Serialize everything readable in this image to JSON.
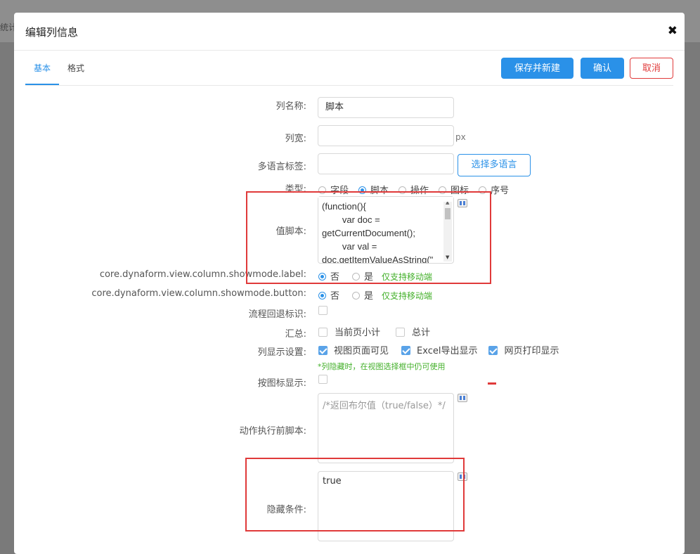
{
  "background": {
    "partial_text": "统计"
  },
  "dialog": {
    "title": "编辑列信息",
    "close_symbol": "✖"
  },
  "tabs": [
    {
      "label": "基本",
      "active": true
    },
    {
      "label": "格式",
      "active": false
    }
  ],
  "buttons": {
    "save_new": "保存并新建",
    "confirm": "确认",
    "cancel": "取消"
  },
  "form": {
    "column_name": {
      "label": "列名称:",
      "value": "脚本"
    },
    "column_width": {
      "label": "列宽:",
      "value": "",
      "unit": "px"
    },
    "i18n_label": {
      "label": "多语言标签:",
      "value": "",
      "button": "选择多语言"
    },
    "type": {
      "label": "类型:",
      "options": [
        "字段",
        "脚本",
        "操作",
        "图标",
        "序号"
      ],
      "selected": "脚本"
    },
    "value_script": {
      "label": "值脚本:",
      "code": "(function(){\n        var doc =\ngetCurrentDocument();\n        var val =\ndoc.getItemValueAsString(\""
    },
    "showmode_label": {
      "label": "core.dynaform.view.column.showmode.label:",
      "options": [
        "否",
        "是"
      ],
      "selected": "否",
      "hint": "仅支持移动端"
    },
    "showmode_button": {
      "label": "core.dynaform.view.column.showmode.button:",
      "options": [
        "否",
        "是"
      ],
      "selected": "否",
      "hint": "仅支持移动端"
    },
    "flow_back": {
      "label": "流程回退标识:",
      "checked": false
    },
    "summary": {
      "label": "汇总:",
      "options": [
        {
          "label": "当前页小计",
          "checked": false
        },
        {
          "label": "总计",
          "checked": false
        }
      ]
    },
    "display": {
      "label": "列显示设置:",
      "options": [
        {
          "label": "视图页面可见",
          "checked": true
        },
        {
          "label": "Excel导出显示",
          "checked": true
        },
        {
          "label": "网页打印显示",
          "checked": true
        }
      ],
      "note": "*列隐藏时，在视图选择框中仍可使用"
    },
    "icon_display": {
      "label": "按图标显示:",
      "checked": false
    },
    "pre_action_script": {
      "label": "动作执行前脚本:",
      "placeholder": "/*返回布尔值（true/false）*/"
    },
    "hidden_condition": {
      "label": "隐藏条件:",
      "value": "true"
    }
  },
  "colors": {
    "primary": "#2a91e8",
    "danger": "#e03a3a",
    "hint": "#43b02a"
  }
}
